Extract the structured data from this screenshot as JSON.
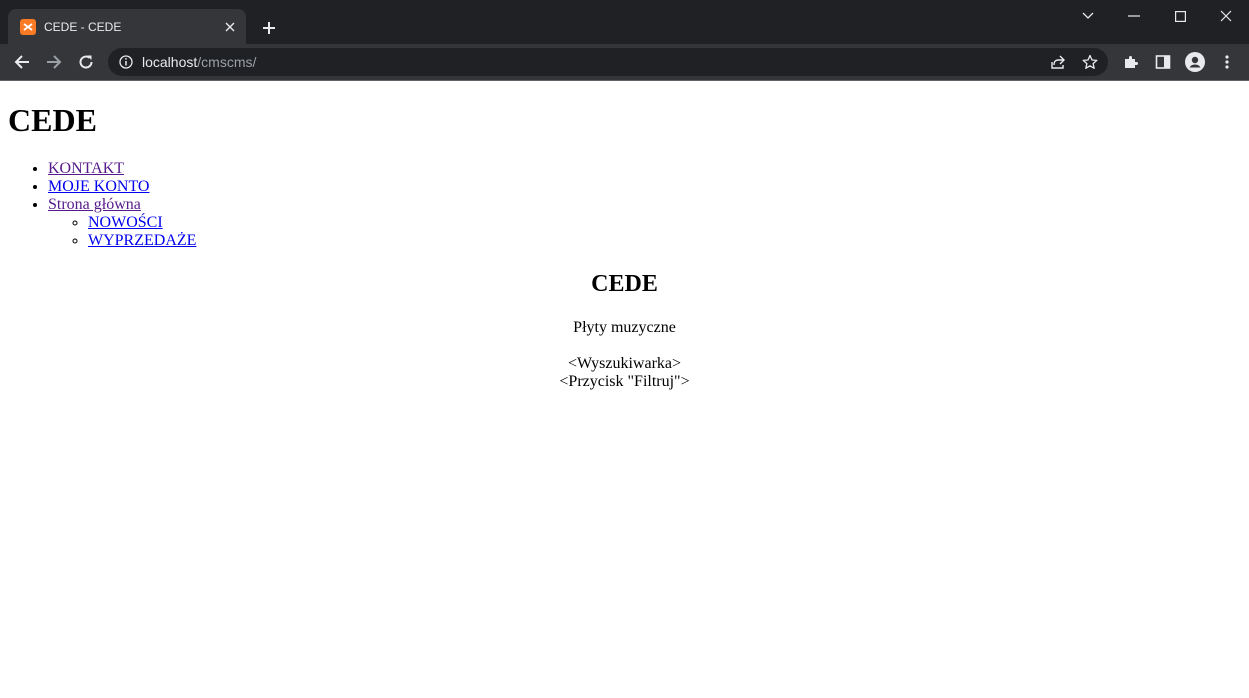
{
  "browser": {
    "tab_title": "CEDE - CEDE",
    "url_host": "localhost",
    "url_path": "/cmscms/"
  },
  "page": {
    "site_title": "CEDE",
    "menu": [
      {
        "label": "KONTAKT"
      },
      {
        "label": "MOJE KONTO"
      },
      {
        "label": "Strona główna",
        "children": [
          {
            "label": "NOWOŚCI"
          },
          {
            "label": "WYPRZEDAŻE"
          }
        ]
      }
    ],
    "heading": "CEDE",
    "subtitle": "Płyty muzyczne",
    "search_placeholder": "<Wyszukiwarka>",
    "filter_placeholder": "<Przycisk \"Filtruj\">"
  },
  "colors": {
    "chrome_dark": "#202124",
    "chrome_tab": "#35363a",
    "favicon": "#fb7a24",
    "link_visited": "#551a8b",
    "link": "#0000ee"
  },
  "icons": [
    "xampp-favicon",
    "close-icon",
    "plus-icon",
    "chevron-down-icon",
    "minimize-icon",
    "maximize-icon",
    "window-close-icon",
    "back-arrow-icon",
    "forward-arrow-icon",
    "reload-icon",
    "info-icon",
    "share-icon",
    "star-icon",
    "extensions-icon",
    "sidepanel-icon",
    "profile-icon",
    "kebab-menu-icon"
  ]
}
